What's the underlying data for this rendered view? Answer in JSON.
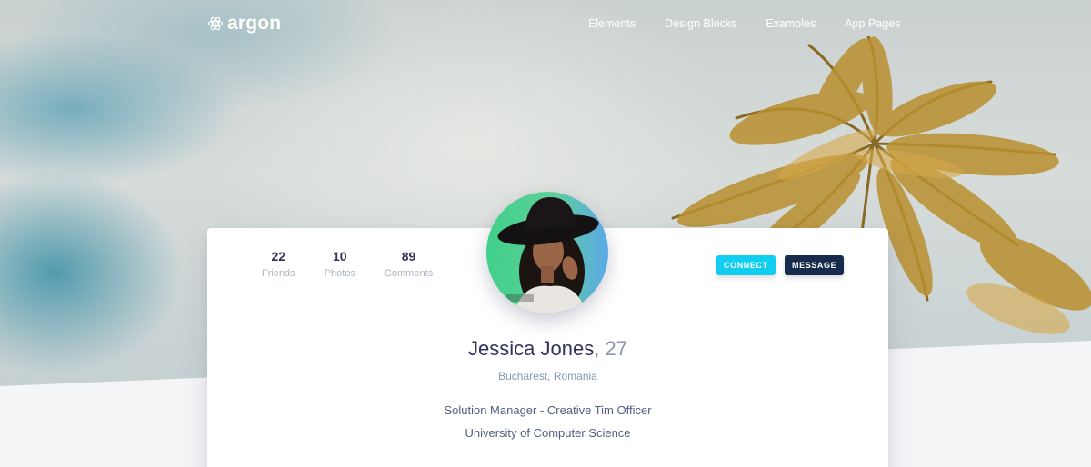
{
  "brand": {
    "name": "argon"
  },
  "nav": {
    "items": [
      {
        "label": "Elements"
      },
      {
        "label": "Design Blocks"
      },
      {
        "label": "Examples"
      },
      {
        "label": "App Pages"
      }
    ]
  },
  "profile": {
    "stats": [
      {
        "value": "22",
        "label": "Friends"
      },
      {
        "value": "10",
        "label": "Photos"
      },
      {
        "value": "89",
        "label": "Comments"
      }
    ],
    "connect_label": "Connect",
    "message_label": "Message",
    "name": "Jessica Jones",
    "age": ", 27",
    "location": "Bucharest, Romania",
    "job": "Solution Manager - Creative Tim Officer",
    "university": "University of Computer Science"
  },
  "colors": {
    "connect": "#11cdef",
    "message": "#172b4d",
    "heading": "#32325d",
    "muted": "#8898aa"
  }
}
